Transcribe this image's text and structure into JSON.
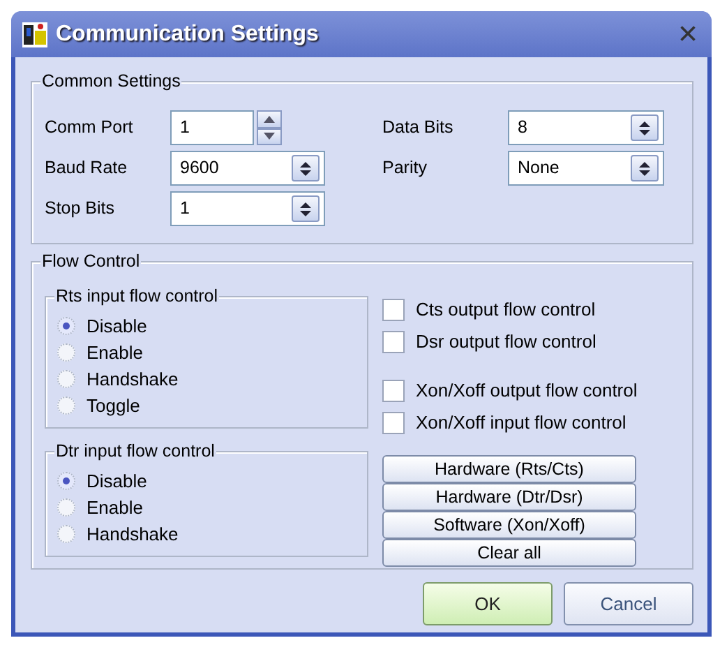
{
  "window": {
    "title": "Communication Settings",
    "close": "×"
  },
  "common_settings": {
    "title": "Common Settings",
    "left_fields": [
      {
        "label": "Comm Port",
        "value": "1",
        "kind": "spinner"
      },
      {
        "label": "Baud Rate",
        "value": "9600",
        "kind": "combo"
      },
      {
        "label": "Stop Bits",
        "value": "1",
        "kind": "combo"
      }
    ],
    "right_fields": [
      {
        "label": "Data Bits",
        "value": "8",
        "kind": "combo"
      },
      {
        "label": "Parity",
        "value": "None",
        "kind": "combo"
      }
    ]
  },
  "flow_control": {
    "title": "Flow Control",
    "radio_groups": [
      {
        "title": "Rts input flow control",
        "options": [
          {
            "label": "Disable",
            "selected": true
          },
          {
            "label": "Enable",
            "selected": false
          },
          {
            "label": "Handshake",
            "selected": false
          },
          {
            "label": "Toggle",
            "selected": false
          }
        ]
      },
      {
        "title": "Dtr input flow control",
        "options": [
          {
            "label": "Disable",
            "selected": true
          },
          {
            "label": "Enable",
            "selected": false
          },
          {
            "label": "Handshake",
            "selected": false
          }
        ]
      }
    ],
    "checkbox_groups": [
      [
        {
          "label": "Cts output flow control",
          "checked": false
        },
        {
          "label": "Dsr output flow control",
          "checked": false
        }
      ],
      [
        {
          "label": "Xon/Xoff output flow control",
          "checked": false
        },
        {
          "label": "Xon/Xoff input flow control",
          "checked": false
        }
      ]
    ],
    "preset_buttons": [
      "Hardware (Rts/Cts)",
      "Hardware (Dtr/Dsr)",
      "Software (Xon/Xoff)",
      "Clear all"
    ]
  },
  "buttons": [
    {
      "label": "OK",
      "kind": "default"
    },
    {
      "label": "Cancel",
      "kind": "normal"
    }
  ]
}
